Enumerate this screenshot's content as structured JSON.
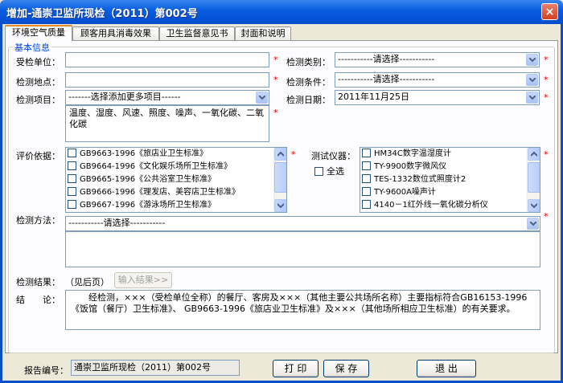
{
  "window": {
    "title": "增加-通崇卫监所现检（2011）第002号",
    "close": "×"
  },
  "tabs": [
    {
      "label": "环境空气质量"
    },
    {
      "label": "顾客用具消毒效果"
    },
    {
      "label": "卫生监督意见书"
    },
    {
      "label": "封面和说明"
    }
  ],
  "group": {
    "label": "基本信息"
  },
  "form": {
    "required_mark": "*",
    "inspected_unit": {
      "label": "受检单位：",
      "value": ""
    },
    "test_category": {
      "label": "检测类别：",
      "value": "-----------请选择-----------"
    },
    "test_location": {
      "label": "检测地点：",
      "value": ""
    },
    "test_condition": {
      "label": "检测条件：",
      "value": "-----------请选择-----------"
    },
    "test_items": {
      "label": "检测项目：",
      "select_value": "-------选择添加更多项目------",
      "text": "温度、湿度、风速、照度、噪声、一氧化碳、二氧化碳"
    },
    "test_date": {
      "label": "检测日期：",
      "value": "2011年11月25日"
    },
    "criteria": {
      "label": "评价依据：",
      "items": [
        "GB9663-1996《旅店业卫生标准》",
        "GB9664-1996《文化娱乐场所卫生标准》",
        "GB9665-1996《公共浴室卫生标准》",
        "GB9666-1996《理发店、美容店卫生标准》",
        "GB9667-1996《游泳场所卫生标准》"
      ]
    },
    "instruments": {
      "label": "测试仪器：",
      "select_all": "全选",
      "items": [
        "HM34C数字温湿度计",
        "TY-9900数字微风仪",
        "TES-1332数位式照度计2",
        "TY-9600A噪声计",
        "4140－1红外线一氧化碳分析仪"
      ]
    },
    "method": {
      "label": "检测方法：",
      "value": "-----------请选择-----------"
    },
    "result": {
      "label": "检测结果：",
      "note": "（见后页）",
      "button": "输入结果>>"
    },
    "conclusion": {
      "label": "结　　论：",
      "text": "　　经检测，×××（受检单位全称）的餐厅、客房及×××（其他主要公共场所名称）主要指标符合GB16153-1996《饭馆（餐厅）卫生标准》、 GB9663-1996《旅店业卫生标准》及×××（其他场所相应卫生标准）的有关要求。"
    }
  },
  "footer": {
    "report_no_label": "报告编号：",
    "report_no": "通崇卫监所现检（2011）第002号",
    "print": "打 印",
    "save": "保 存",
    "exit": "退 出"
  },
  "icons": {
    "dropdown": "chevron-down-icon",
    "scroll_up": "arrow-up-icon",
    "scroll_down": "arrow-down-icon"
  }
}
